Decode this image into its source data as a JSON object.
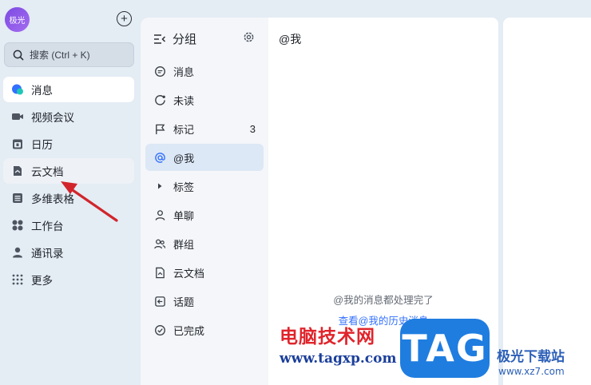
{
  "profile": {
    "avatar_text": "极光"
  },
  "search": {
    "label": "搜索 (Ctrl + K)"
  },
  "nav": {
    "items": [
      {
        "label": "消息",
        "icon": "message-icon"
      },
      {
        "label": "视频会议",
        "icon": "video-icon"
      },
      {
        "label": "日历",
        "icon": "calendar-icon"
      },
      {
        "label": "云文档",
        "icon": "cloud-doc-icon"
      },
      {
        "label": "多维表格",
        "icon": "table-icon"
      },
      {
        "label": "工作台",
        "icon": "workspace-icon"
      },
      {
        "label": "通讯录",
        "icon": "contacts-icon"
      },
      {
        "label": "更多",
        "icon": "more-icon"
      }
    ]
  },
  "panel": {
    "title": "分组",
    "items": [
      {
        "label": "消息",
        "icon": "chat-icon",
        "count": ""
      },
      {
        "label": "未读",
        "icon": "unread-icon",
        "count": ""
      },
      {
        "label": "标记",
        "icon": "flag-icon",
        "count": "3"
      },
      {
        "label": "@我",
        "icon": "at-icon",
        "count": ""
      },
      {
        "label": "标签",
        "icon": "caret-right-icon",
        "count": ""
      },
      {
        "label": "单聊",
        "icon": "person-icon",
        "count": ""
      },
      {
        "label": "群组",
        "icon": "group-icon",
        "count": ""
      },
      {
        "label": "云文档",
        "icon": "doc-icon",
        "count": ""
      },
      {
        "label": "话题",
        "icon": "topic-icon",
        "count": ""
      },
      {
        "label": "已完成",
        "icon": "check-icon",
        "count": ""
      }
    ]
  },
  "main": {
    "title": "@我",
    "empty_message": "@我的消息都处理完了",
    "history_link": "查看@我的历史消息"
  },
  "watermark": {
    "cn_text": "电脑技术网",
    "url": "www.tagxp.com",
    "badge": "TAG",
    "site_name": "极光下载站",
    "site_url": "www.xz7.com"
  },
  "colors": {
    "accent": "#3370ff",
    "active_group_bg": "#dde8f6",
    "annotation_arrow": "#d1252b"
  }
}
